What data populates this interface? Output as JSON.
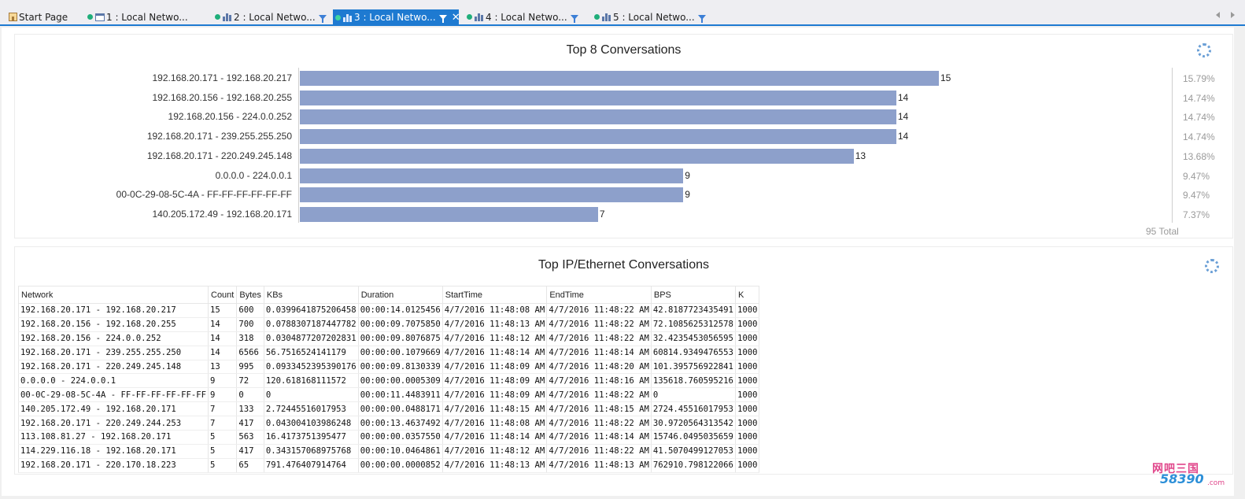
{
  "tabs": [
    {
      "label": "Start Page",
      "icon": "home-icon",
      "dot": false,
      "filter": false,
      "active": false
    },
    {
      "label": "1 : Local Netwo...",
      "icon": "table-icon",
      "dot": true,
      "filter": false,
      "active": false
    },
    {
      "label": "2 : Local Netwo...",
      "icon": "chart-icon",
      "dot": true,
      "filter": true,
      "active": false
    },
    {
      "label": "3 : Local Netwo...",
      "icon": "chart-icon",
      "dot": true,
      "filter": true,
      "active": true
    },
    {
      "label": "4 : Local Netwo...",
      "icon": "chart-icon",
      "dot": true,
      "filter": true,
      "active": false
    },
    {
      "label": "5 : Local Netwo...",
      "icon": "chart-icon",
      "dot": true,
      "filter": true,
      "active": false
    }
  ],
  "chart_panel": {
    "title": "Top 8 Conversations",
    "total_label": "95 Total"
  },
  "chart_data": {
    "type": "bar",
    "orientation": "horizontal",
    "title": "Top 8 Conversations",
    "categories": [
      "192.168.20.171 - 192.168.20.217",
      "192.168.20.156 - 192.168.20.255",
      "192.168.20.156 - 224.0.0.252",
      "192.168.20.171 - 239.255.255.250",
      "192.168.20.171 - 220.249.245.148",
      "0.0.0.0 - 224.0.0.1",
      "00-0C-29-08-5C-4A - FF-FF-FF-FF-FF-FF",
      "140.205.172.49 - 192.168.20.171"
    ],
    "values": [
      15,
      14,
      14,
      14,
      13,
      9,
      9,
      7
    ],
    "percent_labels": [
      "15.79%",
      "14.74%",
      "14.74%",
      "14.74%",
      "13.68%",
      "9.47%",
      "9.47%",
      "7.37%"
    ],
    "xlim": [
      0,
      15
    ],
    "color": "#8da0cb",
    "total": "95 Total"
  },
  "table_panel": {
    "title": "Top IP/Ethernet Conversations",
    "columns": [
      "Network",
      "Count",
      "Bytes",
      "KBs",
      "Duration",
      "StartTime",
      "EndTime",
      "BPS",
      "K"
    ],
    "rows": [
      [
        "192.168.20.171 - 192.168.20.217",
        "15",
        "600",
        "0.0399641875206458",
        "00:00:14.0125456",
        "4/7/2016 11:48:08 AM",
        "4/7/2016 11:48:22 AM",
        "42.8187723435491",
        "1000"
      ],
      [
        "192.168.20.156 - 192.168.20.255",
        "14",
        "700",
        "0.0788307187447782",
        "00:00:09.7075850",
        "4/7/2016 11:48:13 AM",
        "4/7/2016 11:48:22 AM",
        "72.1085625312578",
        "1000"
      ],
      [
        "192.168.20.156 - 224.0.0.252",
        "14",
        "318",
        "0.0304877207202831",
        "00:00:09.8076875",
        "4/7/2016 11:48:12 AM",
        "4/7/2016 11:48:22 AM",
        "32.4235453056595",
        "1000"
      ],
      [
        "192.168.20.171 - 239.255.255.250",
        "14",
        "6566",
        "56.7516524141179",
        "00:00:00.1079669",
        "4/7/2016 11:48:14 AM",
        "4/7/2016 11:48:14 AM",
        "60814.9349476553",
        "1000"
      ],
      [
        "192.168.20.171 - 220.249.245.148",
        "13",
        "995",
        "0.0933452395390176",
        "00:00:09.8130339",
        "4/7/2016 11:48:09 AM",
        "4/7/2016 11:48:20 AM",
        "101.395756922841",
        "1000"
      ],
      [
        "0.0.0.0 - 224.0.0.1",
        "9",
        "72",
        "120.618168111572",
        "00:00:00.0005309",
        "4/7/2016 11:48:09 AM",
        "4/7/2016 11:48:16 AM",
        "135618.760595216",
        "1000"
      ],
      [
        "00-0C-29-08-5C-4A - FF-FF-FF-FF-FF-FF",
        "9",
        "0",
        "0",
        "00:00:11.4483911",
        "4/7/2016 11:48:09 AM",
        "4/7/2016 11:48:22 AM",
        "0",
        "1000"
      ],
      [
        "140.205.172.49 - 192.168.20.171",
        "7",
        "133",
        "2.72445516017953",
        "00:00:00.0488171",
        "4/7/2016 11:48:15 AM",
        "4/7/2016 11:48:15 AM",
        "2724.45516017953",
        "1000"
      ],
      [
        "192.168.20.171 - 220.249.244.253",
        "7",
        "417",
        "0.043004103986248",
        "00:00:13.4637492",
        "4/7/2016 11:48:08 AM",
        "4/7/2016 11:48:22 AM",
        "30.9720564313542",
        "1000"
      ],
      [
        "113.108.81.27 - 192.168.20.171",
        "5",
        "563",
        "16.4173751395477",
        "00:00:00.0357550",
        "4/7/2016 11:48:14 AM",
        "4/7/2016 11:48:14 AM",
        "15746.0495035659",
        "1000"
      ],
      [
        "114.229.116.18 - 192.168.20.171",
        "5",
        "417",
        "0.343157068975768",
        "00:00:10.0464861",
        "4/7/2016 11:48:12 AM",
        "4/7/2016 11:48:22 AM",
        "41.5070499127053",
        "1000"
      ],
      [
        "192.168.20.171 - 220.170.18.223",
        "5",
        "65",
        "791.476407914764",
        "00:00:00.0000852",
        "4/7/2016 11:48:13 AM",
        "4/7/2016 11:48:13 AM",
        "762910.798122066",
        "1000"
      ]
    ]
  },
  "watermark": {
    "top": "网吧三国",
    "bottom": "58390",
    "suffix": ".com"
  },
  "colors": {
    "accent": "#1e7ad1",
    "bar": "#8da0cb",
    "status_dot": "#1fae7a"
  }
}
